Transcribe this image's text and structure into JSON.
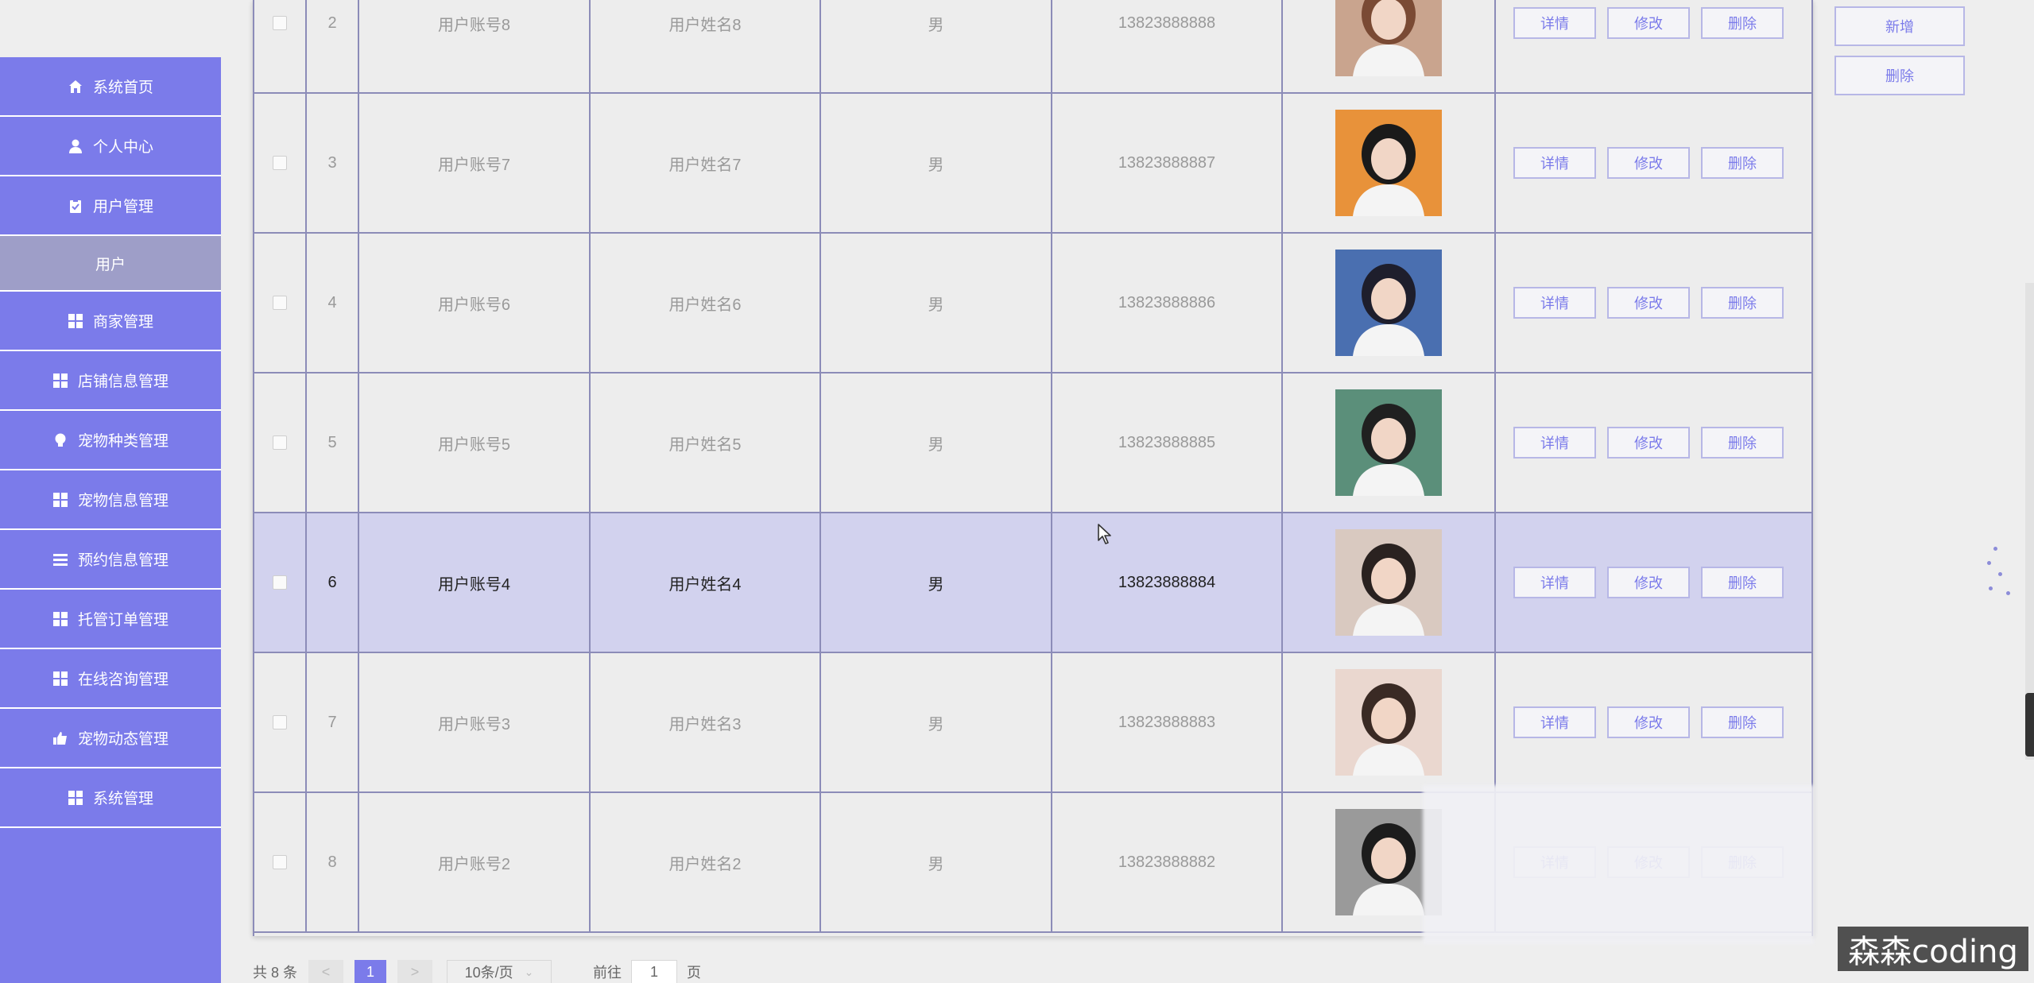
{
  "sidebar": {
    "items": [
      {
        "label": "系统首页",
        "icon": "home-icon"
      },
      {
        "label": "个人中心",
        "icon": "user-icon"
      },
      {
        "label": "用户管理",
        "icon": "clipboard-icon"
      },
      {
        "label": "用户",
        "icon": "",
        "sub": true
      },
      {
        "label": "商家管理",
        "icon": "grid-icon"
      },
      {
        "label": "店铺信息管理",
        "icon": "grid-icon"
      },
      {
        "label": "宠物种类管理",
        "icon": "bulb-icon"
      },
      {
        "label": "宠物信息管理",
        "icon": "grid-icon"
      },
      {
        "label": "预约信息管理",
        "icon": "list-icon"
      },
      {
        "label": "托管订单管理",
        "icon": "grid-icon"
      },
      {
        "label": "在线咨询管理",
        "icon": "grid-icon"
      },
      {
        "label": "宠物动态管理",
        "icon": "thumb-icon"
      },
      {
        "label": "系统管理",
        "icon": "grid-icon"
      }
    ]
  },
  "actions": {
    "add_label": "新增",
    "delete_label": "删除"
  },
  "table": {
    "op_labels": {
      "detail": "详情",
      "edit": "修改",
      "delete": "删除"
    },
    "rows": [
      {
        "index": "2",
        "account": "用户账号8",
        "name": "用户姓名8",
        "gender": "男",
        "phone": "13823888888",
        "highlighted": false
      },
      {
        "index": "3",
        "account": "用户账号7",
        "name": "用户姓名7",
        "gender": "男",
        "phone": "13823888887",
        "highlighted": false
      },
      {
        "index": "4",
        "account": "用户账号6",
        "name": "用户姓名6",
        "gender": "男",
        "phone": "13823888886",
        "highlighted": false
      },
      {
        "index": "5",
        "account": "用户账号5",
        "name": "用户姓名5",
        "gender": "男",
        "phone": "13823888885",
        "highlighted": false
      },
      {
        "index": "6",
        "account": "用户账号4",
        "name": "用户姓名4",
        "gender": "男",
        "phone": "13823888884",
        "highlighted": true
      },
      {
        "index": "7",
        "account": "用户账号3",
        "name": "用户姓名3",
        "gender": "男",
        "phone": "13823888883",
        "highlighted": false
      },
      {
        "index": "8",
        "account": "用户账号2",
        "name": "用户姓名2",
        "gender": "男",
        "phone": "13823888882",
        "highlighted": false
      }
    ]
  },
  "pagination": {
    "total_text": "共 8 条",
    "prev": "<",
    "current_page": "1",
    "next": ">",
    "page_size": "10条/页",
    "goto_prefix": "前往",
    "goto_value": "1",
    "goto_suffix": "页"
  },
  "watermark": "森森coding",
  "colors": {
    "accent": "#7b7bea",
    "sidebar_sub": "#9e9ec8",
    "row_highlight": "#d2d2ee",
    "grid_line": "#8c8cb8"
  }
}
